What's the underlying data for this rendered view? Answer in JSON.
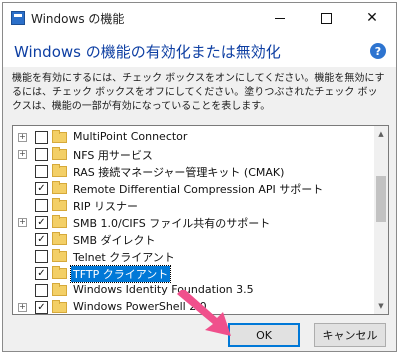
{
  "window": {
    "title": "Windows の機能",
    "heading": "Windows の機能の有効化または無効化",
    "description": "機能を有効にするには、チェック ボックスをオンにしてください。機能を無効にするには、チェック ボックスをオフにしてください。塗りつぶされたチェック ボックスは、機能の一部が有効になっていることを表します。"
  },
  "features": [
    {
      "label": "MultiPoint Connector",
      "expandable": true,
      "state": "unchecked",
      "selected": false
    },
    {
      "label": "NFS 用サービス",
      "expandable": true,
      "state": "unchecked",
      "selected": false
    },
    {
      "label": "RAS 接続マネージャー管理キット (CMAK)",
      "expandable": false,
      "state": "unchecked",
      "selected": false
    },
    {
      "label": "Remote Differential Compression API サポート",
      "expandable": false,
      "state": "checked",
      "selected": false
    },
    {
      "label": "RIP リスナー",
      "expandable": false,
      "state": "unchecked",
      "selected": false
    },
    {
      "label": "SMB 1.0/CIFS ファイル共有のサポート",
      "expandable": true,
      "state": "checked",
      "selected": false
    },
    {
      "label": "SMB ダイレクト",
      "expandable": false,
      "state": "checked",
      "selected": false
    },
    {
      "label": "Telnet クライアント",
      "expandable": false,
      "state": "unchecked",
      "selected": false
    },
    {
      "label": "TFTP クライアント",
      "expandable": false,
      "state": "checked",
      "selected": true
    },
    {
      "label": "Windows Identity Foundation 3.5",
      "expandable": false,
      "state": "unchecked",
      "selected": false
    },
    {
      "label": "Windows PowerShell 2.0",
      "expandable": true,
      "state": "checked",
      "selected": false
    }
  ],
  "buttons": {
    "ok": "OK",
    "cancel": "キャンセル"
  },
  "icons": {
    "help": "?",
    "close": "✕",
    "scroll_up": "▲",
    "scroll_down": "▼"
  },
  "colors": {
    "accent": "#0078d7",
    "heading": "#0e3fa3",
    "arrow": "#f0508c"
  }
}
